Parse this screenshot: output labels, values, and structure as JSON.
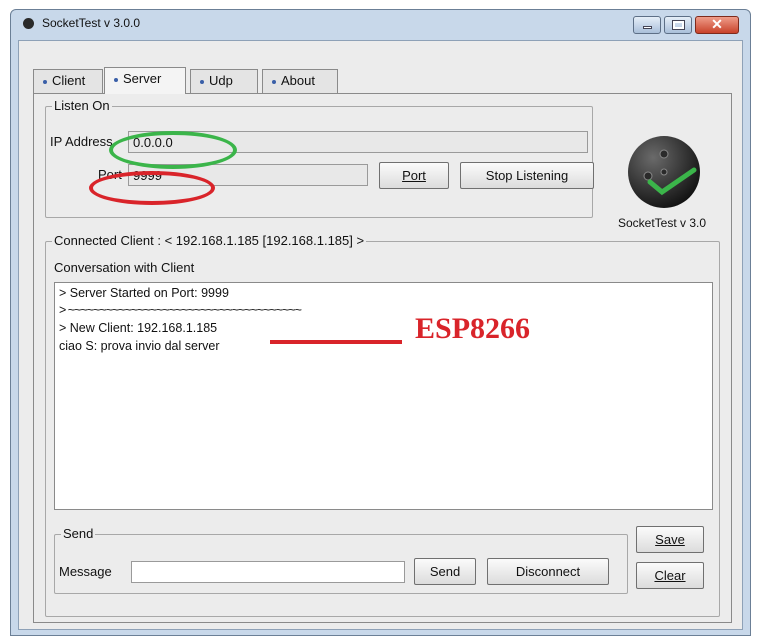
{
  "window": {
    "title": "SocketTest v 3.0.0"
  },
  "tabs": [
    {
      "label": "Client",
      "active": false
    },
    {
      "label": "Server",
      "active": true
    },
    {
      "label": "Udp",
      "active": false
    },
    {
      "label": "About",
      "active": false
    }
  ],
  "listen": {
    "legend": "Listen On",
    "ip_label": "IP Address",
    "ip_value": "0.0.0.0",
    "port_label": "Port",
    "port_value": "9999",
    "port_button": "Port",
    "stop_button": "Stop Listening"
  },
  "logo": {
    "caption": "SocketTest v 3.0"
  },
  "connected": {
    "legend": "Connected Client : <  192.168.1.185 [192.168.1.185]  >",
    "conversation_label": "Conversation with Client",
    "lines": [
      "> Server Started on Port: 9999",
      "> ~~~~~~~~~~~~~~~~~~~~~~~~~~~~~~~~~~~~~",
      "> New Client: 192.168.1.185",
      "ciao S: prova invio dal server"
    ]
  },
  "annotation": {
    "text": "ESP8266"
  },
  "send": {
    "legend": "Send",
    "message_label": "Message",
    "message_value": "",
    "send_button": "Send",
    "disconnect_button": "Disconnect"
  },
  "side_buttons": {
    "save": "Save",
    "clear": "Clear"
  },
  "colors": {
    "green_mark": "#3bb54a",
    "red_mark": "#d9242a",
    "logo_check": "#3bb54a"
  }
}
